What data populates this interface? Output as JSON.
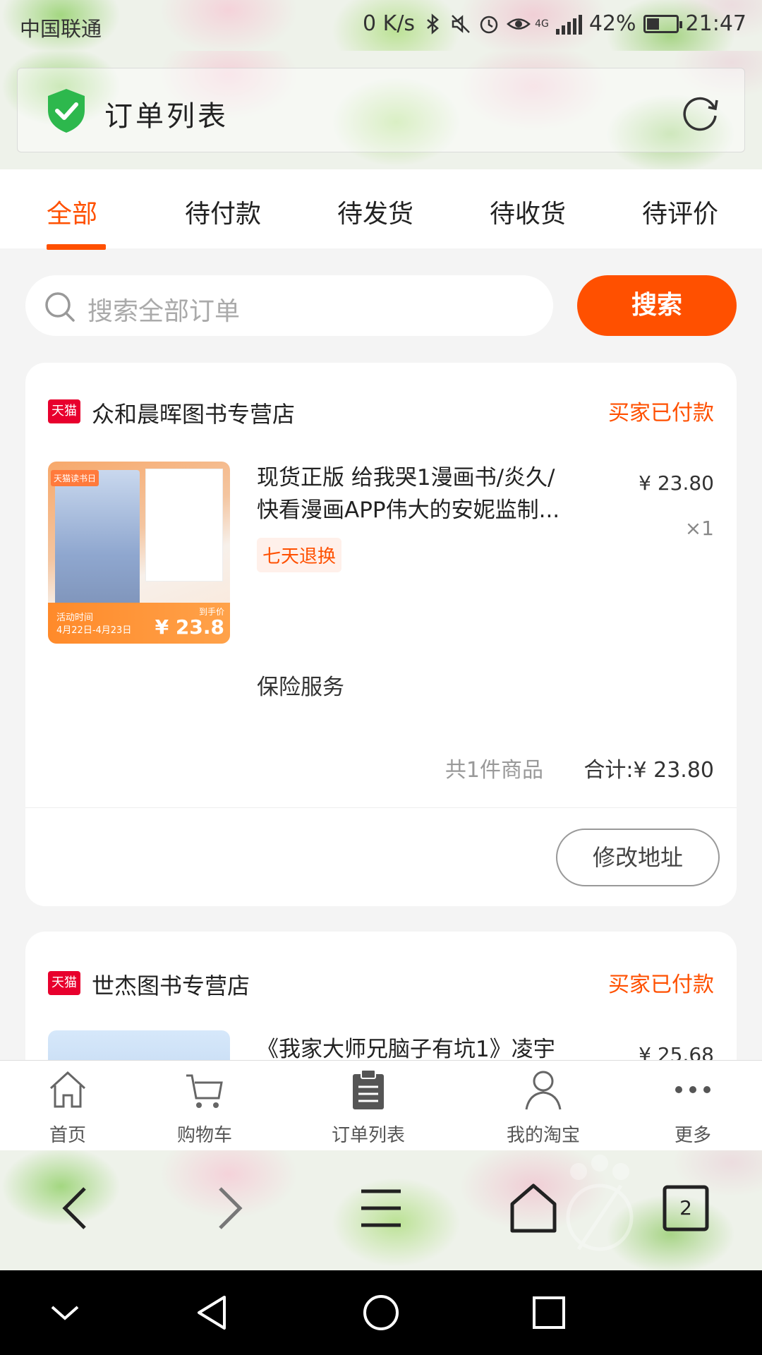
{
  "status_bar": {
    "carrier": "中国联通",
    "speed": "0 K/s",
    "network": "4G",
    "battery": "42%",
    "time": "21:47"
  },
  "header": {
    "title": "订单列表"
  },
  "tabs": [
    {
      "label": "全部",
      "active": true
    },
    {
      "label": "待付款",
      "active": false
    },
    {
      "label": "待发货",
      "active": false
    },
    {
      "label": "待收货",
      "active": false
    },
    {
      "label": "待评价",
      "active": false
    }
  ],
  "search": {
    "placeholder": "搜索全部订单",
    "button_label": "搜索"
  },
  "orders": [
    {
      "shop_logo": "天猫",
      "shop_name": "众和晨晖图书专营店",
      "status": "买家已付款",
      "thumb": {
        "brand": "天猫读书日",
        "activity_label": "活动时间",
        "activity_dates": "4月22日-4月23日",
        "price_label": "到手价",
        "price": "¥ 23.8"
      },
      "title_line1": "现货正版 给我哭1漫画书/炎久/",
      "title_line2": "快看漫画APP伟大的安妮监制...",
      "price": "¥ 23.80",
      "quantity": "×1",
      "return_badge": "七天退换",
      "insurance": "保险服务",
      "item_count": "共1件商品",
      "total": "合计:¥ 23.80",
      "action_button": "修改地址"
    },
    {
      "shop_logo": "天猫",
      "shop_name": "世杰图书专营店",
      "status": "买家已付款",
      "title_line1": "《我家大师兄脑子有坑1》凌宇",
      "price": "¥ 25.68"
    }
  ],
  "app_tabbar": [
    {
      "label": "首页",
      "icon": "home-icon"
    },
    {
      "label": "购物车",
      "icon": "cart-icon"
    },
    {
      "label": "订单列表",
      "icon": "clipboard-icon"
    },
    {
      "label": "我的淘宝",
      "icon": "user-icon"
    },
    {
      "label": "更多",
      "icon": "more-icon"
    }
  ],
  "browser_bar": {
    "tab_count": "2"
  },
  "colors": {
    "accent": "#ff5000",
    "tmall_red": "#e8002d"
  }
}
